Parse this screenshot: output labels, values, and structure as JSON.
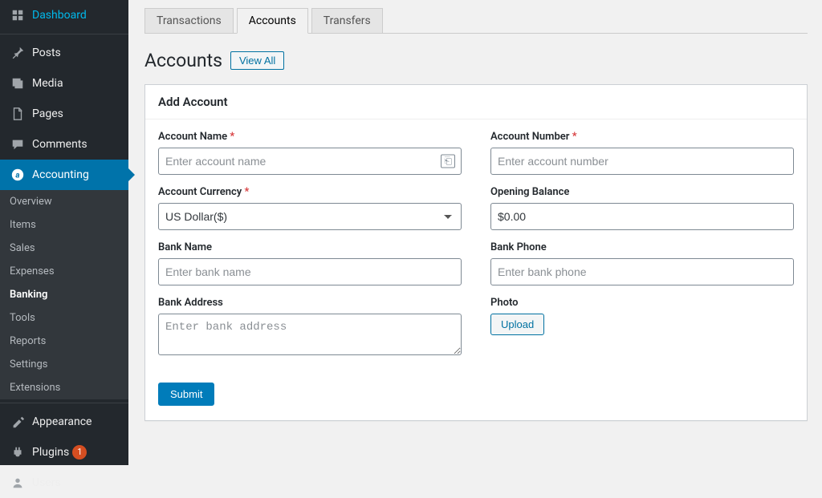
{
  "sidebar": {
    "items": [
      {
        "label": "Dashboard",
        "icon": "dashboard"
      },
      {
        "label": "Posts",
        "icon": "pin"
      },
      {
        "label": "Media",
        "icon": "media"
      },
      {
        "label": "Pages",
        "icon": "pages"
      },
      {
        "label": "Comments",
        "icon": "comments"
      },
      {
        "label": "Accounting",
        "icon": "accounting",
        "active": true
      },
      {
        "label": "Appearance",
        "icon": "appearance"
      },
      {
        "label": "Plugins",
        "icon": "plugins",
        "badge": "1"
      },
      {
        "label": "Users",
        "icon": "users"
      }
    ],
    "submenu": [
      {
        "label": "Overview"
      },
      {
        "label": "Items"
      },
      {
        "label": "Sales"
      },
      {
        "label": "Expenses"
      },
      {
        "label": "Banking",
        "current": true
      },
      {
        "label": "Tools"
      },
      {
        "label": "Reports"
      },
      {
        "label": "Settings"
      },
      {
        "label": "Extensions"
      }
    ]
  },
  "tabs": [
    {
      "label": "Transactions"
    },
    {
      "label": "Accounts",
      "active": true
    },
    {
      "label": "Transfers"
    }
  ],
  "page": {
    "title": "Accounts",
    "view_all": "View All"
  },
  "panel": {
    "title": "Add Account"
  },
  "form": {
    "account_name": {
      "label": "Account Name",
      "placeholder": "Enter account name",
      "required": true
    },
    "account_number": {
      "label": "Account Number",
      "placeholder": "Enter account number",
      "required": true
    },
    "account_currency": {
      "label": "Account Currency",
      "value": "US Dollar($)",
      "required": true
    },
    "opening_balance": {
      "label": "Opening Balance",
      "value": "$0.00"
    },
    "bank_name": {
      "label": "Bank Name",
      "placeholder": "Enter bank name"
    },
    "bank_phone": {
      "label": "Bank Phone",
      "placeholder": "Enter bank phone"
    },
    "bank_address": {
      "label": "Bank Address",
      "placeholder": "Enter bank address"
    },
    "photo": {
      "label": "Photo",
      "upload": "Upload"
    },
    "submit": "Submit"
  }
}
